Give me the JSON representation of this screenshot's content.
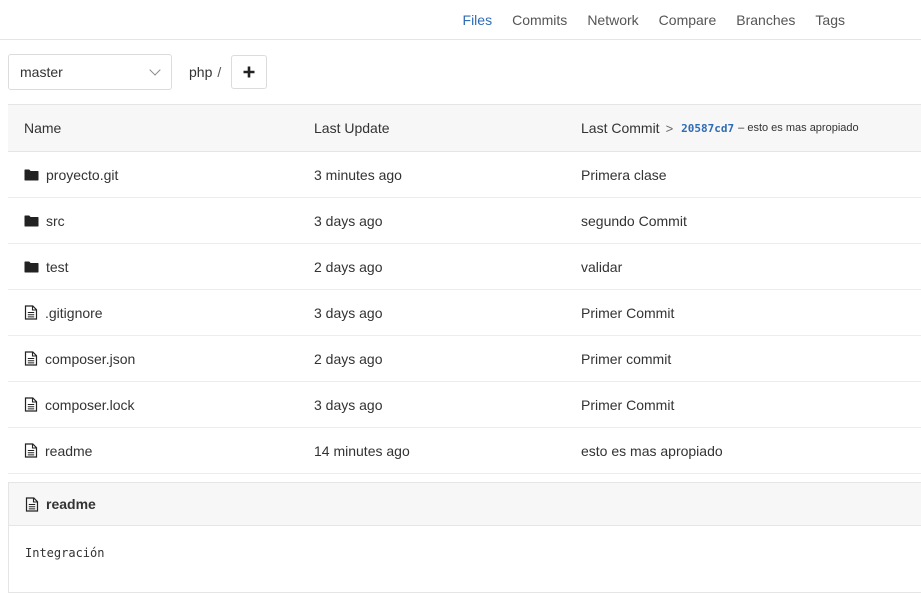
{
  "nav": {
    "tabs": [
      {
        "label": "Files",
        "active": true
      },
      {
        "label": "Commits",
        "active": false
      },
      {
        "label": "Network",
        "active": false
      },
      {
        "label": "Compare",
        "active": false
      },
      {
        "label": "Branches",
        "active": false
      },
      {
        "label": "Tags",
        "active": false
      }
    ]
  },
  "toolbar": {
    "branch": "master",
    "path_root": "php",
    "path_sep": "/",
    "add_icon": "plus-icon"
  },
  "tree": {
    "headers": {
      "name": "Name",
      "last_update": "Last Update",
      "last_commit": "Last Commit",
      "chevron": ">",
      "commit_sha": "20587cd7",
      "commit_message": "– esto es mas apropiado"
    },
    "rows": [
      {
        "icon": "folder-icon",
        "name": "proyecto.git",
        "updated": "3 minutes ago",
        "commit": "Primera clase"
      },
      {
        "icon": "folder-icon",
        "name": "src",
        "updated": "3 days ago",
        "commit": "segundo Commit"
      },
      {
        "icon": "folder-icon",
        "name": "test",
        "updated": "2 days ago",
        "commit": "validar"
      },
      {
        "icon": "file-icon",
        "name": ".gitignore",
        "updated": "3 days ago",
        "commit": "Primer Commit"
      },
      {
        "icon": "file-icon",
        "name": "composer.json",
        "updated": "2 days ago",
        "commit": "Primer commit"
      },
      {
        "icon": "file-icon",
        "name": "composer.lock",
        "updated": "3 days ago",
        "commit": "Primer Commit"
      },
      {
        "icon": "file-icon",
        "name": "readme",
        "updated": "14 minutes ago",
        "commit": "esto es mas apropiado"
      }
    ]
  },
  "readme": {
    "icon": "file-icon",
    "title": "readme",
    "content": "Integración"
  },
  "colors": {
    "link": "#2f6cb5",
    "header_bg": "#f7f7f7",
    "border": "#e5e5e5"
  }
}
